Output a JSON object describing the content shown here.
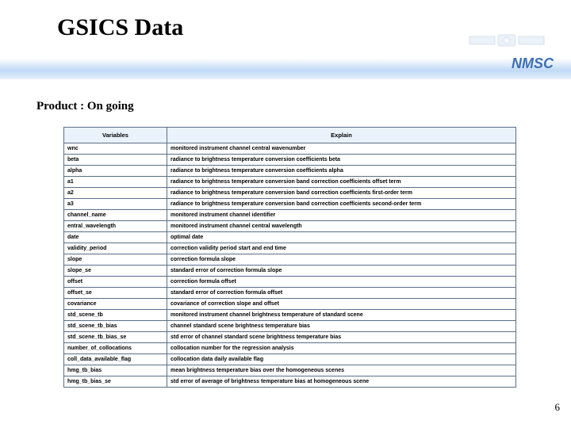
{
  "header": {
    "title": "GSICS Data",
    "brand": "NMSC",
    "subtitle": "Product : On going"
  },
  "table": {
    "cols": {
      "var": "Variables",
      "exp": "Explain"
    },
    "rows": [
      {
        "v": "wnc",
        "e": "monitored instrument channel central wavenumber"
      },
      {
        "v": "beta",
        "e": "radiance to brightness temperature conversion coefficients beta"
      },
      {
        "v": "alpha",
        "e": "radiance to brightness temperature conversion coefficients alpha"
      },
      {
        "v": "a1",
        "e": "radiance to brightness temperature conversion band correction coefficients offset term"
      },
      {
        "v": "a2",
        "e": "radiance to brightness temperature conversion band correction coefficients first-order term"
      },
      {
        "v": "a3",
        "e": "radiance to brightness temperature conversion band correction coefficients second-order term"
      },
      {
        "v": "channel_name",
        "e": "monitored instrument channel identifier"
      },
      {
        "v": "entral_wavelength",
        "e": "monitored instrument channel central wavelength"
      },
      {
        "v": "date",
        "e": "optimal date"
      },
      {
        "v": "validity_period",
        "e": "correction validity period start and end time"
      },
      {
        "v": "slope",
        "e": "correction formula slope"
      },
      {
        "v": "slope_se",
        "e": "standard error of correction formula slope"
      },
      {
        "v": "offset",
        "e": "correction formula offset"
      },
      {
        "v": "offset_se",
        "e": "standard error of correction formula offset"
      },
      {
        "v": "covariance",
        "e": "covariance of correction slope and offset"
      },
      {
        "v": "std_scene_tb",
        "e": "monitored instrument channel brightness temperature of standard scene"
      },
      {
        "v": "std_scene_tb_bias",
        "e": "channel standard scene brightness temperature bias"
      },
      {
        "v": "std_scene_tb_bias_se",
        "e": "std error of channel standard scene brightness temperature bias"
      },
      {
        "v": "number_of_collocations",
        "e": "collocation number for the regression analysis"
      },
      {
        "v": "coll_data_available_flag",
        "e": "collocation data daily available flag"
      },
      {
        "v": "hmg_tb_bias",
        "e": "mean brightness temperature bias over the homogeneous scenes"
      },
      {
        "v": "hmg_tb_bias_se",
        "e": "std error of average of brightness temperature bias at homogeneous scene"
      }
    ]
  },
  "page_number": "6"
}
